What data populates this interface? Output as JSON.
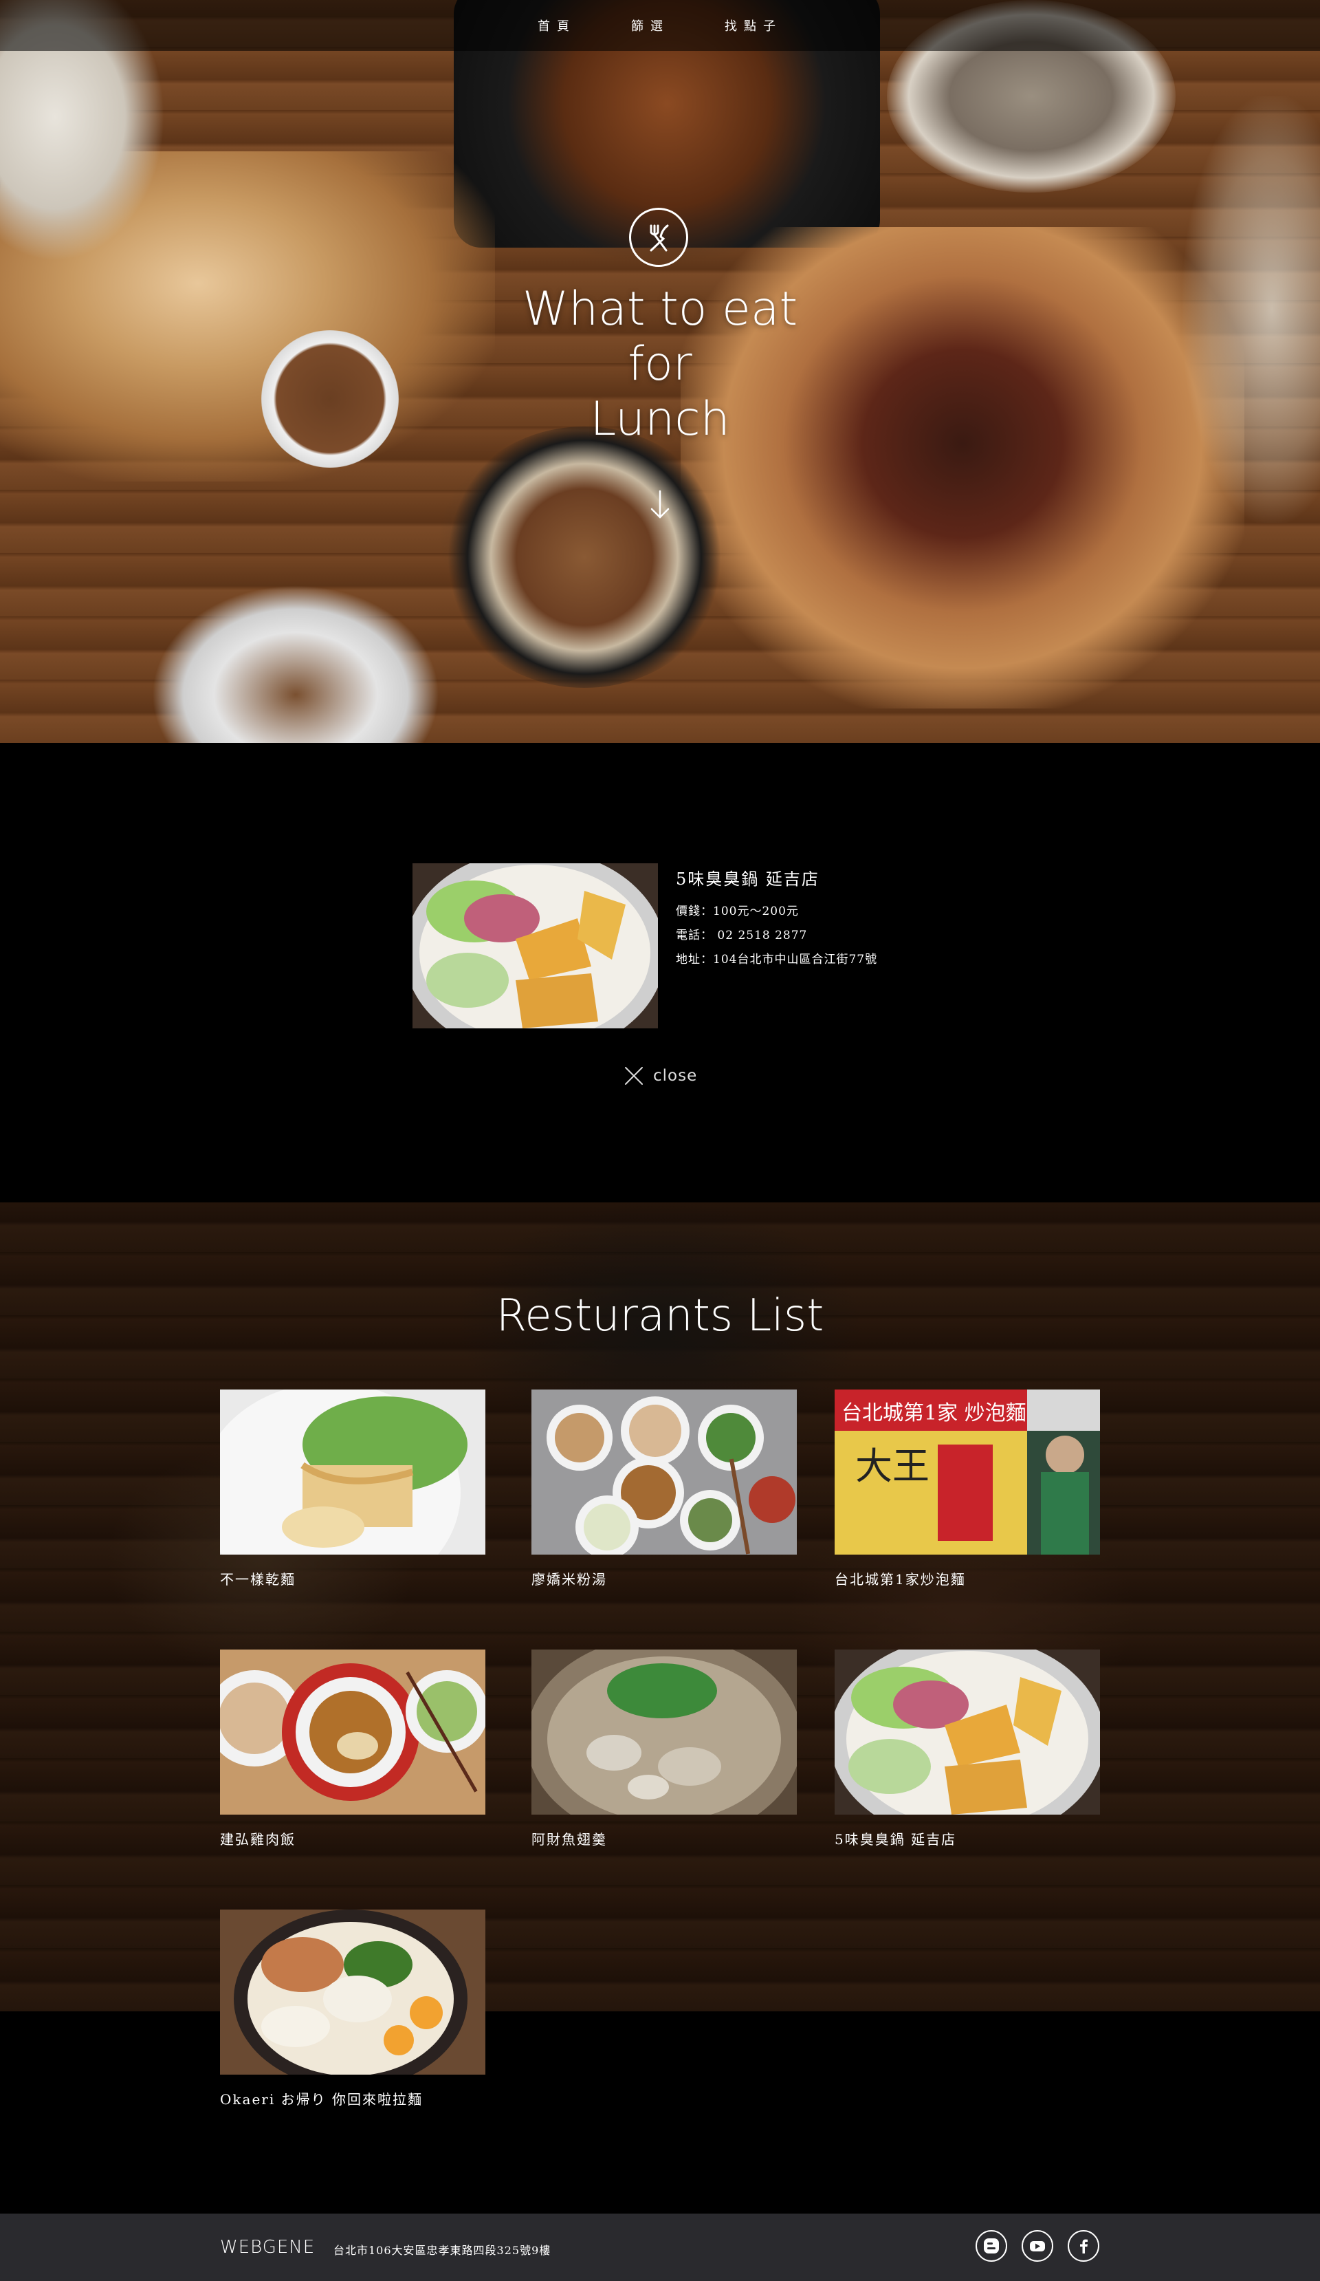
{
  "nav": {
    "items": [
      "首頁",
      "篩選",
      "找點子"
    ]
  },
  "hero": {
    "title_lines": [
      "What to eat",
      "for",
      "Lunch"
    ]
  },
  "detail": {
    "name": "5味臭臭鍋 延吉店",
    "price": "價錢：100元～200元",
    "phone": "電話： 02 2518 2877",
    "address": "地址：104台北市中山區合江街77號",
    "close_label": "close"
  },
  "list": {
    "title": "Resturants List",
    "restaurants": [
      {
        "name": "不一樣乾麵"
      },
      {
        "name": "廖嬌米粉湯"
      },
      {
        "name": "台北城第1家炒泡麵"
      },
      {
        "name": "建弘雞肉飯"
      },
      {
        "name": "阿財魚翅羹"
      },
      {
        "name": "5味臭臭鍋 延吉店"
      },
      {
        "name": "Okaeri お帰り 你回來啦拉麵"
      }
    ],
    "sign_text": "台北城第1家 炒泡麵"
  },
  "footer": {
    "brand": "WEBGENE",
    "address": "台北市106大安區忠孝東路四段325號9樓",
    "social_icons": [
      "blogger-icon",
      "youtube-icon",
      "facebook-icon"
    ]
  }
}
